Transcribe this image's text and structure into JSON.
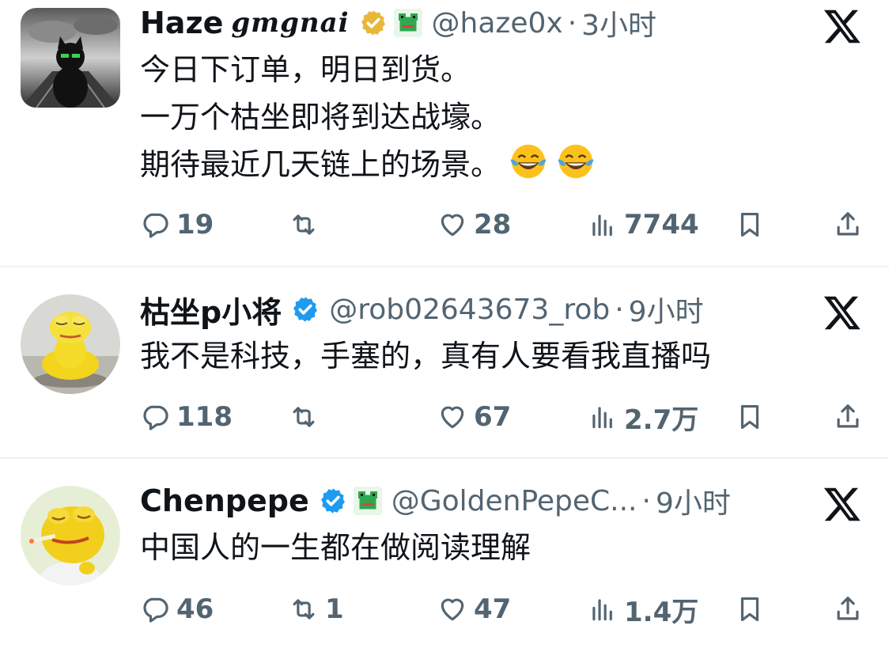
{
  "tweets": [
    {
      "name": "Haze",
      "name_deco": "gmgnai",
      "handle": "@haze0x",
      "dot": "·",
      "time": "3小时",
      "badge_color": "#e8b73a",
      "lines": [
        "今日下订单，明日到货。",
        "一万个枯坐即将到达战壕。",
        "期待最近几天链上的场景。"
      ],
      "emoji": [
        "face-with-tears-of-joy",
        "face-with-tears-of-joy"
      ],
      "stats": {
        "reply": "19",
        "retweet": "",
        "like": "28",
        "views": "7744"
      }
    },
    {
      "name": "枯坐p小将",
      "handle": "@rob02643673_rob",
      "dot": "·",
      "time": "9小时",
      "badge_color": "#1d9bf0",
      "lines": [
        "我不是科技，手塞的，真有人要看我直播吗"
      ],
      "stats": {
        "reply": "118",
        "retweet": "",
        "like": "67",
        "views": "2.7万"
      }
    },
    {
      "name": "Chenpepe",
      "handle": "@GoldenPepeC...",
      "dot": "·",
      "time": "9小时",
      "badge_color": "#1d9bf0",
      "lines": [
        "中国人的一生都在做阅读理解"
      ],
      "stats": {
        "reply": "46",
        "retweet": "1",
        "like": "47",
        "views": "1.4万"
      }
    }
  ],
  "icons": [
    "x-logo-icon",
    "verified-badge-icon",
    "frog-emoji-icon",
    "reply-icon",
    "retweet-icon",
    "like-icon",
    "views-icon",
    "bookmark-icon",
    "share-icon"
  ],
  "colors": {
    "text": "#0f1419",
    "secondary": "#536471",
    "divider": "#eff3f4",
    "verified_blue": "#1d9bf0",
    "verified_gold": "#e8b73a"
  }
}
